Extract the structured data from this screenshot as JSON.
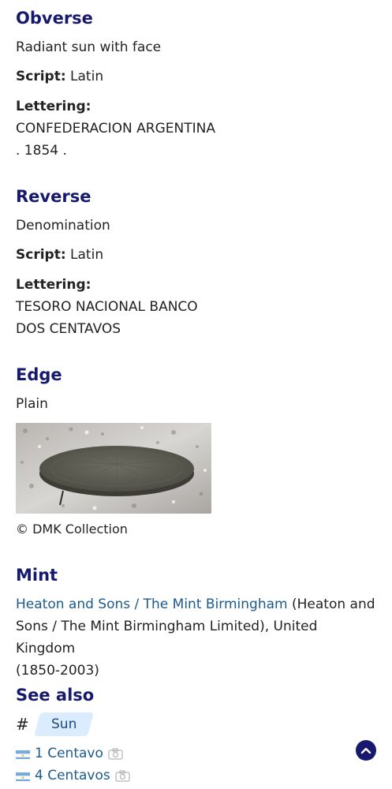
{
  "obverse": {
    "title": "Obverse",
    "description": "Radiant sun with face",
    "script_label": "Script:",
    "script_value": "Latin",
    "lettering_label": "Lettering:",
    "lettering_line1": "CONFEDERACION ARGENTINA",
    "lettering_line2": ". 1854 ."
  },
  "reverse": {
    "title": "Reverse",
    "description": "Denomination",
    "script_label": "Script:",
    "script_value": "Latin",
    "lettering_label": "Lettering:",
    "lettering_line1": "TESORO NACIONAL BANCO",
    "lettering_line2": "DOS CENTAVOS"
  },
  "edge": {
    "title": "Edge",
    "description": "Plain",
    "photo_credit": "© DMK Collection"
  },
  "mint": {
    "title": "Mint",
    "link_text": "Heaton and Sons / The Mint Birmingham",
    "detail_line1": " (Heaton and",
    "detail_line2": "Sons / The Mint Birmingham Limited), United Kingdom",
    "detail_line3": "(1850-2003)"
  },
  "see_also": {
    "title": "See also",
    "hash": "#",
    "tag": "Sun",
    "related": [
      {
        "label": "1 Centavo",
        "icon": "camera-icon"
      },
      {
        "label": "4 Centavos",
        "icon": "camera-icon"
      }
    ]
  },
  "colors": {
    "heading": "#16196e",
    "link": "#1c5a8d",
    "tag_bg": "#dcecff"
  }
}
